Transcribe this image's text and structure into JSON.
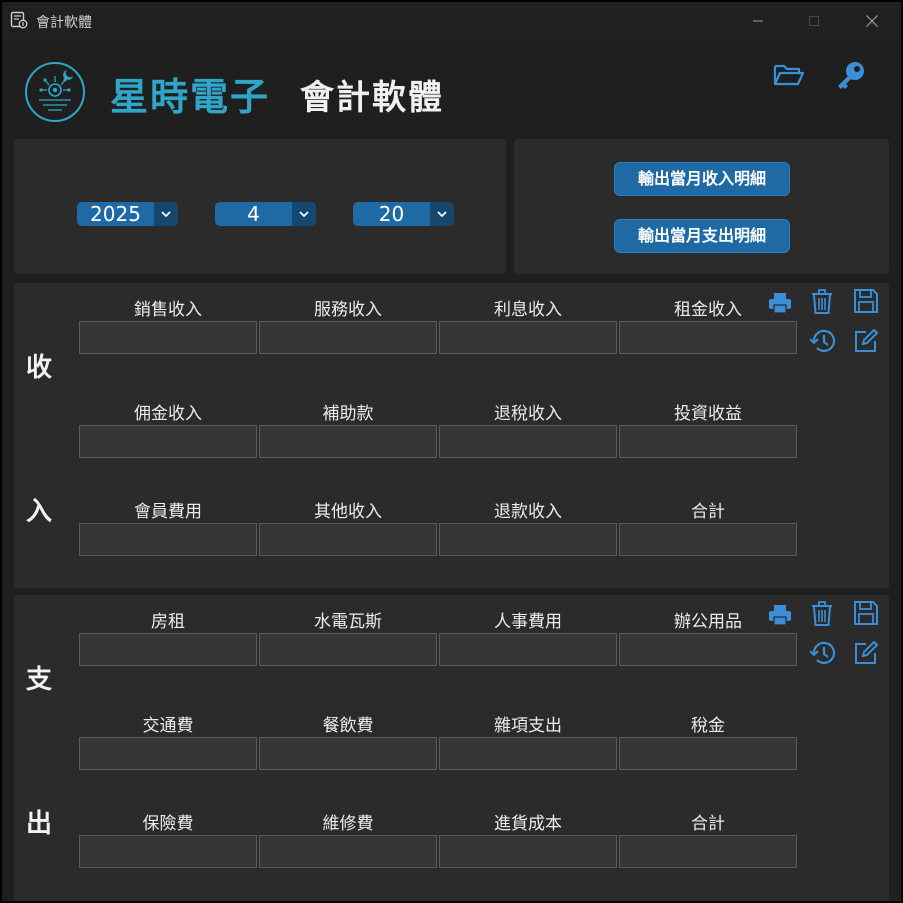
{
  "window": {
    "title": "會計軟體"
  },
  "header": {
    "brand": "星時電子",
    "subtitle": "會計軟體"
  },
  "date": {
    "year": "2025",
    "month": "4",
    "day": "20"
  },
  "export": {
    "income_label": "輸出當月收入明細",
    "expense_label": "輸出當月支出明細"
  },
  "income": {
    "side_top": "收",
    "side_bottom": "入",
    "rows": [
      [
        "銷售收入",
        "服務收入",
        "利息收入",
        "租金收入"
      ],
      [
        "佣金收入",
        "補助款",
        "退稅收入",
        "投資收益"
      ],
      [
        "會員費用",
        "其他收入",
        "退款收入",
        "合計"
      ]
    ]
  },
  "expense": {
    "side_top": "支",
    "side_bottom": "出",
    "rows": [
      [
        "房租",
        "水電瓦斯",
        "人事費用",
        "辦公用品"
      ],
      [
        "交通費",
        "餐飲費",
        "雜項支出",
        "稅金"
      ],
      [
        "保險費",
        "維修費",
        "進貨成本",
        "合計"
      ]
    ]
  },
  "colors": {
    "accent": "#1f6aa5",
    "brand": "#2fa6c8",
    "panel": "#2b2b2b",
    "field": "#343638"
  }
}
